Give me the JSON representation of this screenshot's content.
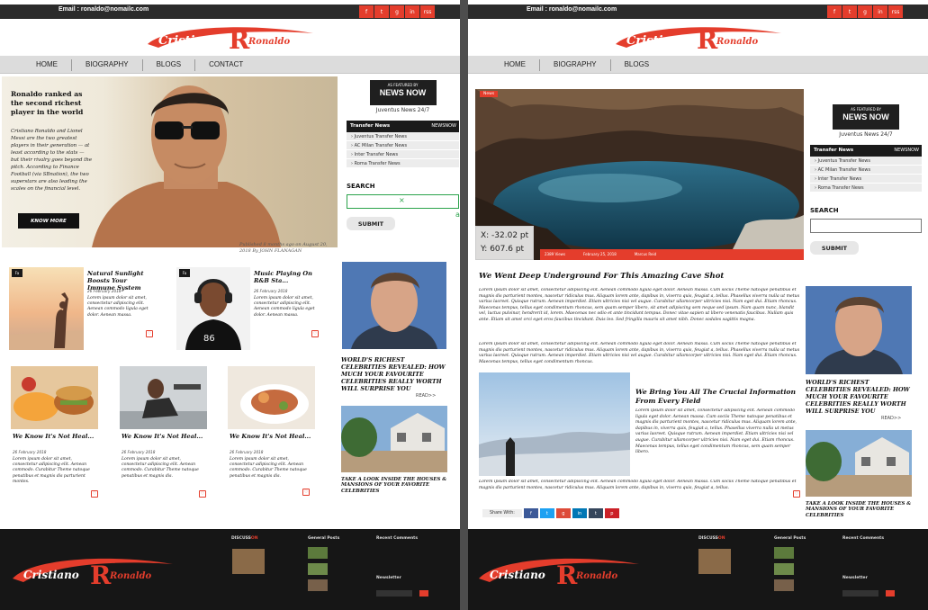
{
  "left": {
    "email": "Email : ronaldo@nomailc.com",
    "social": [
      "f",
      "t",
      "g",
      "in",
      "rss"
    ],
    "logo": {
      "first": "Cristiano",
      "initial": "CR",
      "last": "Ronaldo"
    },
    "nav": [
      "HOME",
      "BIOGRAPHY",
      "BLOGS",
      "CONTACT"
    ],
    "hero": {
      "headline": "Ronaldo ranked as the second richest player in the world",
      "body": "Cristiano Ronaldo and Lionel Messi are the two greatest players in their generation — at least according to the stats — but their rivalry goes beyond the pitch. According to Finance Football (via SBnation), the two superstars are also leading the scales on the financial level.",
      "button": "KNOW MORE",
      "published": "Published 8 months ago on August 20, 2018 By JOHN FLANAGAN"
    },
    "cards_top": [
      {
        "badge": "Fa",
        "title": "Natural Sunlight Boosts Your Immune System",
        "date": "26 February 2018",
        "text": "Lorem ipsum dolor sit amet, consectetur adipiscing elit. Aenean commodo ligula eget dolor. Aenean massa."
      },
      {
        "badge": "Fa",
        "title": "Music Playing On R&B Sta...",
        "date": "26 February 2018",
        "text": "Lorem ipsum dolor sit amet, consectetur adipiscing elit. Aenean commodo ligula eget dolor. Aenean massa."
      }
    ],
    "cards_bottom": [
      {
        "title": "We Know It's Not Heal...",
        "date": "26 February 2018",
        "text": "Lorem ipsum dolor sit amet, consectetur adipiscing elit. Aenean commodo. Curabitur Theme natoque penatibus et magnis dis parturient montes."
      },
      {
        "title": "We Know It's Not Heal...",
        "date": "26 February 2018",
        "text": "Lorem ipsum dolor sit amet, consectetur adipiscing elit. Aenean commodo. Curabitur Theme natoque penatibus et magnis dis."
      },
      {
        "title": "We Know It's Not Heal...",
        "date": "26 February 2018",
        "text": "Lorem ipsum dolor sit amet, consectetur adipiscing elit. Aenean commodo. Curabitur Theme natoque penatibus et magnis dis."
      }
    ],
    "sidebar": {
      "news_now_top": "AS FEATURED BY",
      "news_now": "NEWS NOW",
      "caption": "Juventus News 24/7",
      "transfer_header": "Transfer News",
      "transfer_right": "NEWSNOW",
      "transfer_items": [
        "Juventus Transfer News",
        "AC Milan Transfer News",
        "Inter Transfer News",
        "Roma Transfer News"
      ],
      "search_label": "SEARCH",
      "submit": "SUBMIT",
      "article_title": "WORLD'S RICHEST CELEBRITIES REVEALED: HOW MUCH YOUR FAVOURITE CELEBRITIES REALLY WORTH WILL SURPRISE YOU",
      "read_more": "READ>>",
      "article2_title": "TAKE A LOOK INSIDE THE HOUSES & MANSIONS OF YOUR FAVORITE CELEBRITIES"
    },
    "anchor_label": "anchor",
    "footer": {
      "discuss": "DISCUSS",
      "discuss_on": "ON",
      "general_posts": "General Posts",
      "recent_comments": "Recent Comments",
      "newsletter": "Newsletter"
    }
  },
  "right": {
    "email": "Email : ronaldo@nomailc.com",
    "nav": [
      "HOME",
      "BIOGRAPHY",
      "BLOGS"
    ],
    "news_badge": "News",
    "coords": {
      "x": "X: -32.02 pt",
      "y": "Y: 607.6 pt"
    },
    "meta": [
      "2389 Views",
      "February 25, 2018",
      "Marcus Reid"
    ],
    "post_title": "We Went Deep Underground For This Amazing Cave Shot",
    "lorem": "Lorem ipsum dolor sit amet, consectetur adipiscing elit. Aenean commodo ligula eget dolor. Aenean massa. Cum sociis Theme natoque penatibus et magnis dis parturient montes, nascetur ridiculus mus. Aliquam lorem ante, dapibus in, viverra quis, feugiat a, tellus. Phasellus viverra nulla ut metus varius laoreet. Quisque rutrum. Aenean imperdiet. Etiam ultricies nisi vel augue. Curabitur ullamcorper ultricies nisi. Nam eget dui. Etiam rhoncus. Maecenas tempus, tellus eget condimentum rhoncus, sem quam semper libero, sit amet adipiscing sem neque sed ipsum. Nam quam nunc, blandit vel, luctus pulvinar, hendrerit id, lorem. Maecenas nec odio et ante tincidunt tempus. Donec vitae sapien ut libero venenatis faucibus. Nullam quis ante. Etiam sit amet orci eget eros faucibus tincidunt. Duis leo. Sed fringilla mauris sit amet nibh. Donec sodales sagittis magna.",
    "lorem2": "Lorem ipsum dolor sit amet, consectetur adipiscing elit. Aenean commodo ligula eget dolor. Aenean massa. Cum sociis Theme natoque penatibus et magnis dis parturient montes, nascetur ridiculus mus. Aliquam lorem ante, dapibus in, viverra quis, feugiat a, tellus. Phasellus viverra nulla ut metus varius laoreet. Quisque rutrum. Aenean imperdiet. Etiam ultricies nisi vel augue. Curabitur ullamcorper ultricies nisi. Nam eget dui. Etiam rhoncus. Maecenas tempus, tellus eget condimentum rhoncus.",
    "sub_title": "We Bring You All The Crucial Information From Every Field",
    "sub_text": "Lorem ipsum dolor sit amet, consectetur adipiscing elit. Aenean commodo ligula eget dolor. Aenean massa. Cum sociis Theme natoque penatibus et magnis dis parturient montes, nascetur ridiculus mus. Aliquam lorem ante, dapibus in, viverra quis, feugiat a, tellus. Phasellus viverra nulla ut metus varius laoreet. Quisque rutrum. Aenean imperdiet. Etiam ultricies nisi vel augue. Curabitur ullamcorper ultricies nisi. Nam eget dui. Etiam rhoncus. Maecenas tempus, tellus eget condimentum rhoncus, sem quam semper libero.",
    "lorem3": "Lorem ipsum dolor sit amet, consectetur adipiscing elit. Aenean commodo ligula eget dolor. Aenean massa. Cum sociis Theme natoque penatibus et magnis dis parturient montes, nascetur ridiculus mus. Aliquam lorem ante, dapibus in, viverra quis, feugiat a, tellus.",
    "share_label": "Share With:",
    "share": [
      "f",
      "t",
      "g",
      "in",
      "t",
      "p"
    ]
  },
  "colors": {
    "brand": "#e43d2c",
    "dark": "#161616"
  }
}
